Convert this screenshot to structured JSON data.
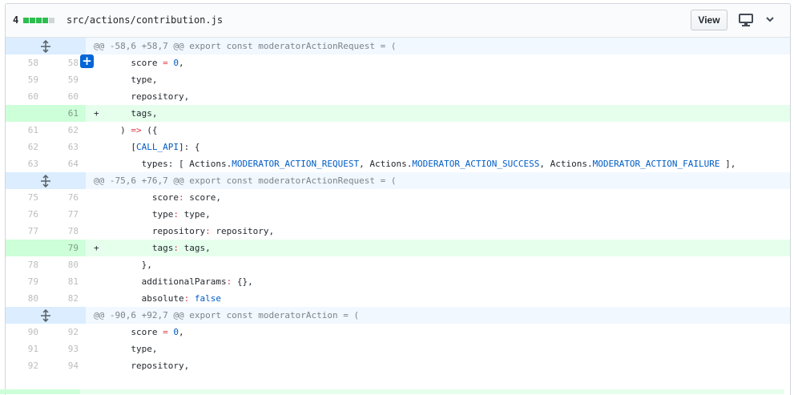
{
  "header": {
    "diffstat_count": "4",
    "diffstat_blocks": [
      "add",
      "add",
      "add",
      "add",
      "neutral"
    ],
    "filename": "src/actions/contribution.js",
    "view_label": "View",
    "icons": [
      "monitor-icon",
      "chevron-down-icon"
    ]
  },
  "colors": {
    "hunk_bg": "#f1f8ff",
    "hunk_gutter_bg": "#dbedff",
    "addition_bg": "#e6ffed",
    "addition_gutter_bg": "#cdffd8",
    "keyword": "#d73a49",
    "constant": "#005cc5",
    "expand_button": "#0366d6"
  },
  "rows": [
    {
      "type": "hunk",
      "text": "@@ -58,6 +58,7 @@ export const moderatorActionRequest = ("
    },
    {
      "type": "ctx",
      "old": "58",
      "new": "58",
      "sign": " ",
      "parts": [
        [
          "",
          "      score "
        ],
        [
          "kw",
          "="
        ],
        [
          "",
          " "
        ],
        [
          "con",
          "0"
        ],
        [
          "",
          ","
        ]
      ]
    },
    {
      "type": "ctx",
      "old": "59",
      "new": "59",
      "sign": " ",
      "parts": [
        [
          "",
          "      type,"
        ]
      ]
    },
    {
      "type": "ctx",
      "old": "60",
      "new": "60",
      "sign": " ",
      "parts": [
        [
          "",
          "      repository,"
        ]
      ]
    },
    {
      "type": "add",
      "old": "",
      "new": "61",
      "sign": "+",
      "parts": [
        [
          "",
          "      tags,"
        ]
      ]
    },
    {
      "type": "ctx",
      "old": "61",
      "new": "62",
      "sign": " ",
      "parts": [
        [
          "",
          "    ) "
        ],
        [
          "kw",
          "=>"
        ],
        [
          "",
          " ({"
        ]
      ]
    },
    {
      "type": "ctx",
      "old": "62",
      "new": "63",
      "sign": " ",
      "parts": [
        [
          "",
          "      ["
        ],
        [
          "con",
          "CALL_API"
        ],
        [
          "",
          "]: {"
        ]
      ]
    },
    {
      "type": "ctx",
      "old": "63",
      "new": "64",
      "sign": " ",
      "parts": [
        [
          "",
          "        types: [ Actions."
        ],
        [
          "con",
          "MODERATOR_ACTION_REQUEST"
        ],
        [
          "",
          ", Actions."
        ],
        [
          "con",
          "MODERATOR_ACTION_SUCCESS"
        ],
        [
          "",
          ", Actions."
        ],
        [
          "con",
          "MODERATOR_ACTION_FAILURE"
        ],
        [
          "",
          " ],"
        ]
      ]
    },
    {
      "type": "hunk",
      "text": "@@ -75,6 +76,7 @@ export const moderatorActionRequest = ("
    },
    {
      "type": "ctx",
      "old": "75",
      "new": "76",
      "sign": " ",
      "parts": [
        [
          "",
          "          score"
        ],
        [
          "kw",
          ":"
        ],
        [
          "",
          " score,"
        ]
      ]
    },
    {
      "type": "ctx",
      "old": "76",
      "new": "77",
      "sign": " ",
      "parts": [
        [
          "",
          "          type"
        ],
        [
          "kw",
          ":"
        ],
        [
          "",
          " type,"
        ]
      ]
    },
    {
      "type": "ctx",
      "old": "77",
      "new": "78",
      "sign": " ",
      "parts": [
        [
          "",
          "          repository"
        ],
        [
          "kw",
          ":"
        ],
        [
          "",
          " repository,"
        ]
      ]
    },
    {
      "type": "add",
      "old": "",
      "new": "79",
      "sign": "+",
      "parts": [
        [
          "",
          "          tags"
        ],
        [
          "kw",
          ":"
        ],
        [
          "",
          " tags,"
        ]
      ]
    },
    {
      "type": "ctx",
      "old": "78",
      "new": "80",
      "sign": " ",
      "parts": [
        [
          "",
          "        },"
        ]
      ]
    },
    {
      "type": "ctx",
      "old": "79",
      "new": "81",
      "sign": " ",
      "parts": [
        [
          "",
          "        additionalParams"
        ],
        [
          "kw",
          ":"
        ],
        [
          "",
          " {},"
        ]
      ]
    },
    {
      "type": "ctx",
      "old": "80",
      "new": "82",
      "sign": " ",
      "parts": [
        [
          "",
          "        absolute"
        ],
        [
          "kw",
          ":"
        ],
        [
          "",
          " "
        ],
        [
          "con",
          "false"
        ]
      ]
    },
    {
      "type": "hunk",
      "text": "@@ -90,6 +92,7 @@ export const moderatorAction = ("
    },
    {
      "type": "ctx",
      "old": "90",
      "new": "92",
      "sign": " ",
      "parts": [
        [
          "",
          "      score "
        ],
        [
          "kw",
          "="
        ],
        [
          "",
          " "
        ],
        [
          "con",
          "0"
        ],
        [
          "",
          ","
        ]
      ]
    },
    {
      "type": "ctx",
      "old": "91",
      "new": "93",
      "sign": " ",
      "parts": [
        [
          "",
          "      type,"
        ]
      ]
    },
    {
      "type": "ctx",
      "old": "92",
      "new": "94",
      "sign": " ",
      "parts": [
        [
          "",
          "      repository,"
        ]
      ]
    }
  ]
}
